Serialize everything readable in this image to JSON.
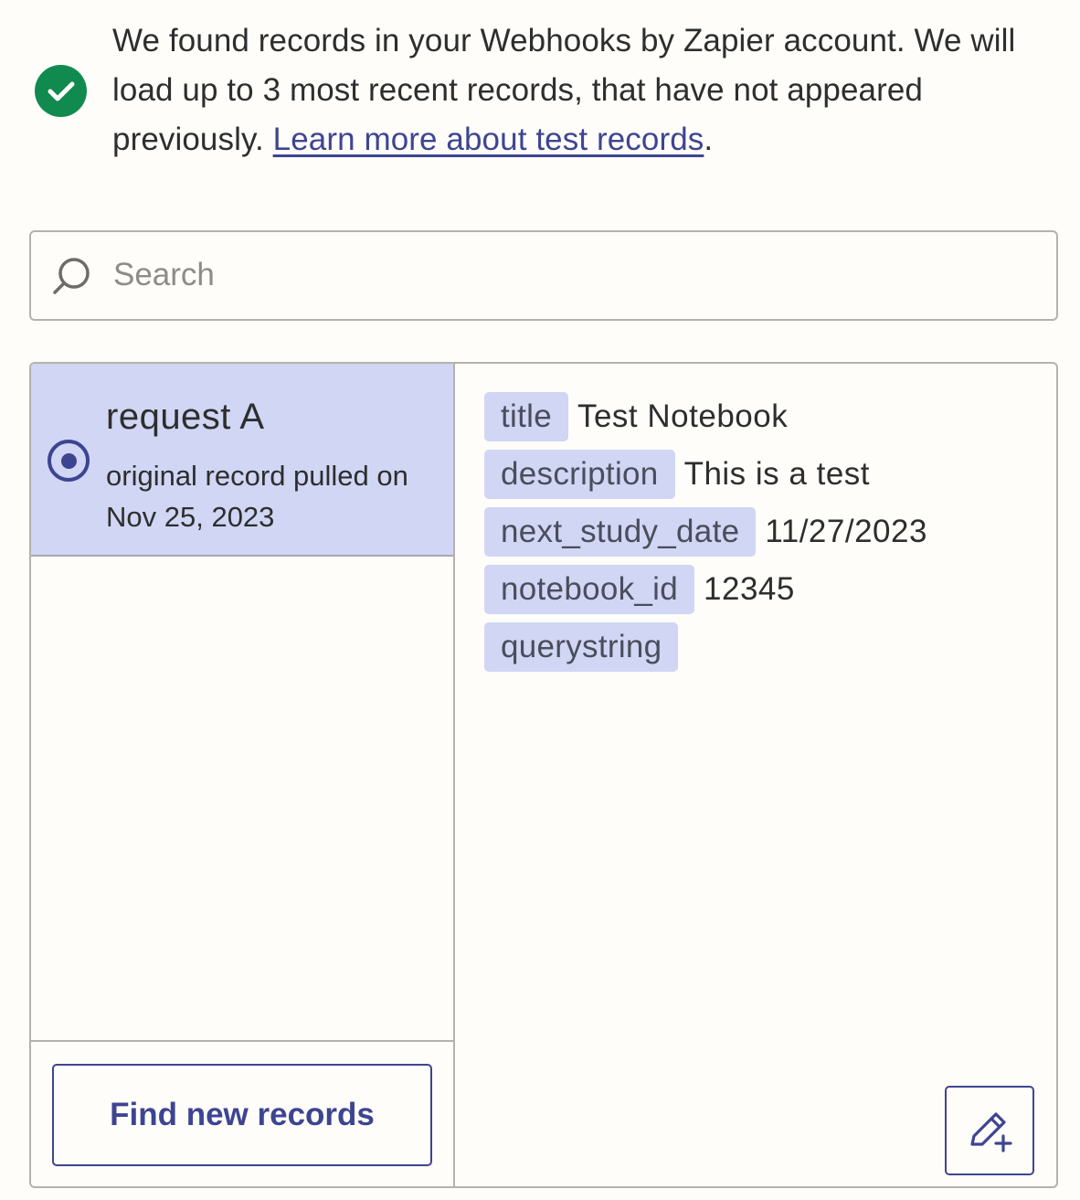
{
  "notice": {
    "text": "We found records in your Webhooks by Zapier account. We will load up to 3 most recent records, that have not appeared previously. ",
    "link_text": "Learn more about test records",
    "suffix": "."
  },
  "search": {
    "placeholder": "Search",
    "value": ""
  },
  "records": [
    {
      "title": "request A",
      "subtitle": "original record pulled on Nov 25, 2023",
      "selected": true
    }
  ],
  "details": [
    {
      "key": "title",
      "value": "Test Notebook"
    },
    {
      "key": "description",
      "value": "This is a test"
    },
    {
      "key": "next_study_date",
      "value": "11/27/2023"
    },
    {
      "key": "notebook_id",
      "value": "12345"
    },
    {
      "key": "querystring",
      "value": ""
    }
  ],
  "actions": {
    "find_new_records": "Find new records",
    "edit_icon": "edit-add-icon"
  },
  "colors": {
    "accent": "#3d4592",
    "success": "#118a4f",
    "selected_bg": "#d0d6f4",
    "page_bg": "#fffdf9"
  }
}
